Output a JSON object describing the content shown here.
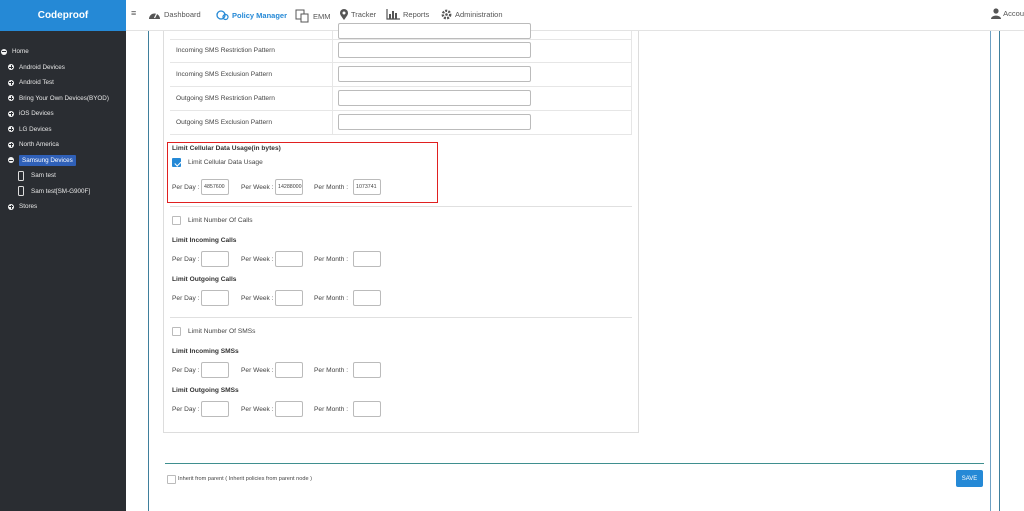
{
  "app": {
    "brand": "Codeproof"
  },
  "nav": {
    "items": [
      {
        "label": "Dashboard",
        "icon": "dashboard-icon"
      },
      {
        "label": "Policy Manager",
        "icon": "policy-manager-icon",
        "active": true
      },
      {
        "label": "EMM",
        "icon": "emm-icon"
      },
      {
        "label": "Tracker",
        "icon": "map-pin-icon"
      },
      {
        "label": "Reports",
        "icon": "bar-chart-icon"
      },
      {
        "label": "Administration",
        "icon": "gear-icon"
      }
    ],
    "account": "Accou"
  },
  "tree": {
    "root": "Home",
    "groups": [
      "Android Devices",
      "Android Test",
      "Bring Your Own Devices(BYOD)",
      "iOS Devices",
      "LG Devices",
      "North America",
      "Samsung Devices"
    ],
    "samsung_devices": [
      "Sam test",
      "Sam test[SM-G900F]"
    ],
    "last": "Stores"
  },
  "sms_patterns": [
    "Incoming SMS Restriction Pattern",
    "Incoming SMS Exclusion Pattern",
    "Outgoing SMS Restriction Pattern",
    "Outgoing SMS Exclusion Pattern"
  ],
  "data_usage": {
    "title": "Limit Cellular Data Usage(in bytes)",
    "checkbox_label": "Limit Cellular Data Usage",
    "checked": true,
    "per_day": "4857600",
    "per_week": "14288000",
    "per_month": "1073741"
  },
  "labels": {
    "per_day": "Per Day :",
    "per_week": "Per Week :",
    "per_month": "Per Month :"
  },
  "calls": {
    "checkbox_label": "Limit Number Of Calls",
    "incoming_title": "Limit Incoming Calls",
    "outgoing_title": "Limit Outgoing Calls"
  },
  "sms": {
    "checkbox_label": "Limit Number Of SMSs",
    "incoming_title": "Limit Incoming SMSs",
    "outgoing_title": "Limit Outgoing SMSs"
  },
  "footer": {
    "inherit_label": "Inherit from parent ( Inherit policies from parent node )",
    "save_label": "SAVE"
  },
  "colors": {
    "accent": "#2589d6",
    "sidebar": "#2a2d32",
    "highlight": "#e02020"
  }
}
